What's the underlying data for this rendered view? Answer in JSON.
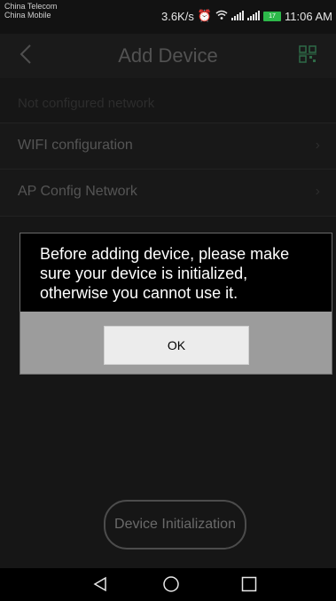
{
  "status_bar": {
    "carrier_1": "China Telecom",
    "carrier_2": "China Mobile",
    "speed": "3.6K/s",
    "battery": "17",
    "time": "11:06 AM"
  },
  "header": {
    "title": "Add Device",
    "back_icon": "chevron-left-icon",
    "scan_icon": "qr-scan-icon"
  },
  "list": {
    "section_label": "Not configured network",
    "items": [
      {
        "label": "WIFI configuration"
      },
      {
        "label": "AP Config Network"
      }
    ]
  },
  "dialog": {
    "message": "Before adding device, please make sure your device is initialized, otherwise you cannot use it.",
    "ok_label": "OK"
  },
  "bottom": {
    "init_label": "Device Initialization"
  },
  "colors": {
    "background": "#161616",
    "dialog_message_bg": "#000000",
    "dialog_footer_bg": "#9c9c9c",
    "battery_green": "#2db84a"
  }
}
